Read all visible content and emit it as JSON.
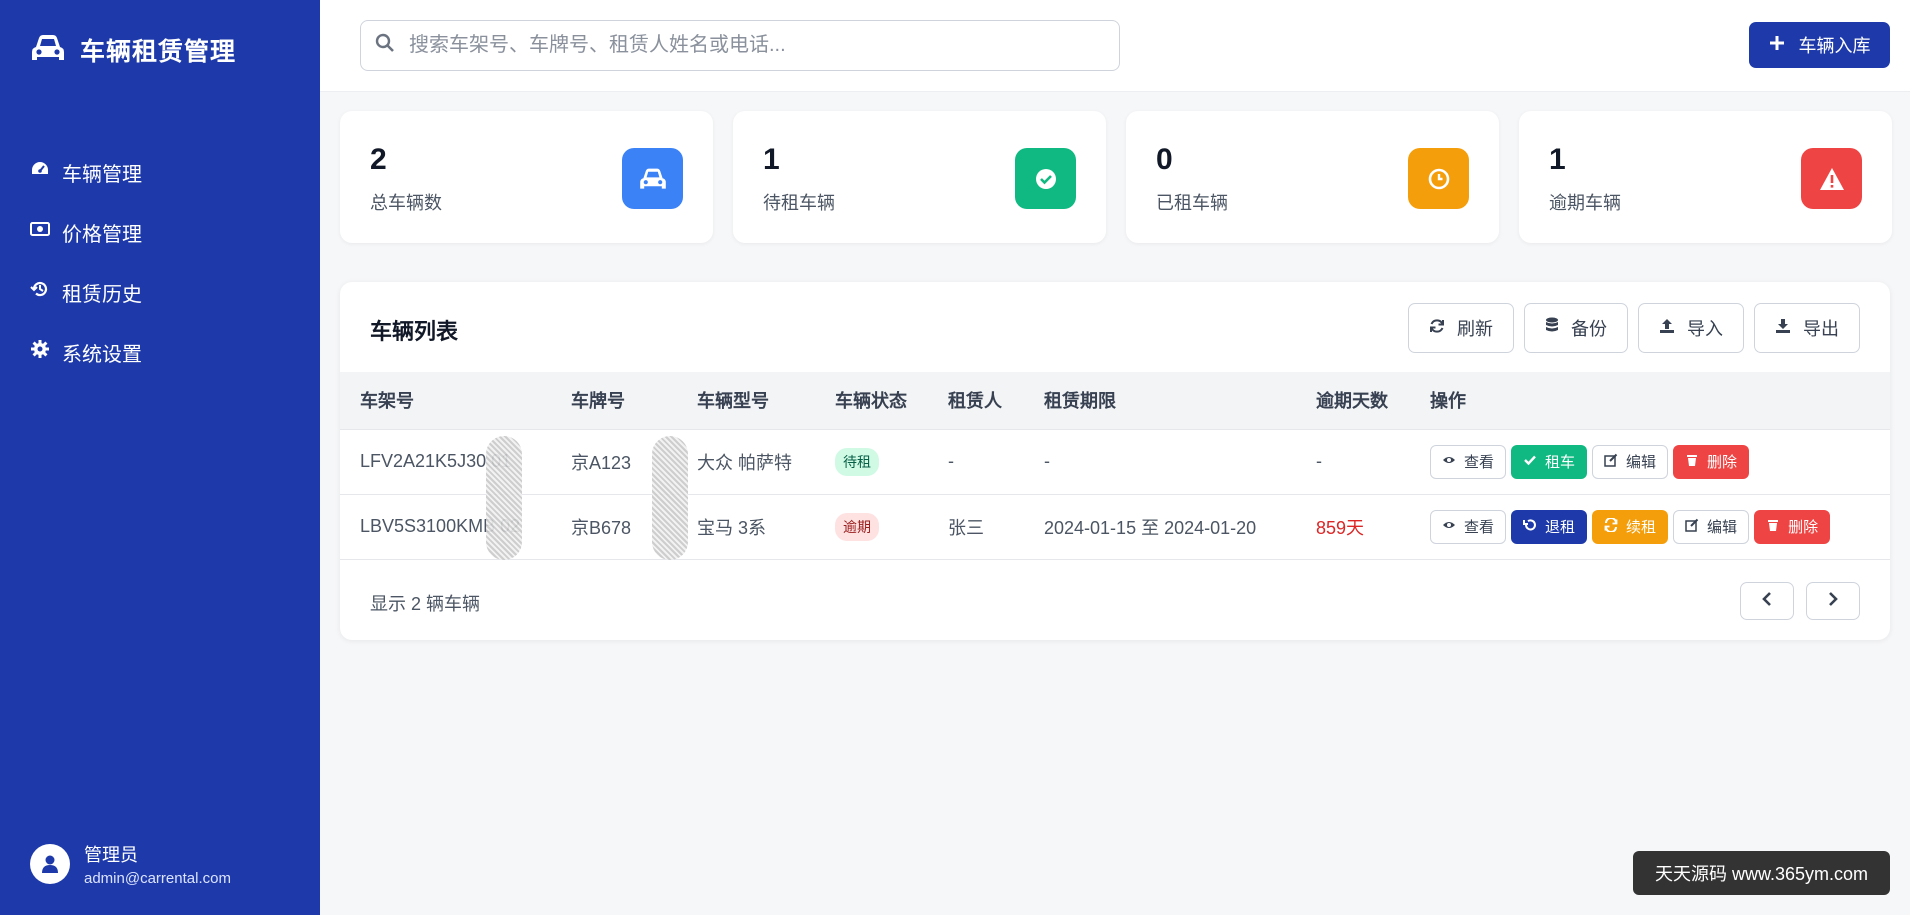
{
  "app": {
    "title": "车辆租赁管理"
  },
  "sidebar": {
    "items": [
      {
        "label": "车辆管理",
        "icon": "dashboard-icon"
      },
      {
        "label": "价格管理",
        "icon": "money-icon"
      },
      {
        "label": "租赁历史",
        "icon": "history-icon"
      },
      {
        "label": "系统设置",
        "icon": "gear-icon"
      }
    ],
    "user": {
      "name": "管理员",
      "email": "admin@carrental.com"
    }
  },
  "topbar": {
    "search_placeholder": "搜索车架号、车牌号、租赁人姓名或电话...",
    "add_label": "车辆入库"
  },
  "stats": [
    {
      "value": "2",
      "label": "总车辆数",
      "color": "#3b82f6",
      "icon": "car-icon"
    },
    {
      "value": "1",
      "label": "待租车辆",
      "color": "#10b981",
      "icon": "check-circle-icon"
    },
    {
      "value": "0",
      "label": "已租车辆",
      "color": "#f59e0b",
      "icon": "clock-icon"
    },
    {
      "value": "1",
      "label": "逾期车辆",
      "color": "#ef4444",
      "icon": "warning-icon"
    }
  ],
  "vehicle_list": {
    "title": "车辆列表",
    "toolbar": {
      "refresh": "刷新",
      "backup": "备份",
      "import": "导入",
      "export": "导出"
    },
    "columns": [
      "车架号",
      "车牌号",
      "车辆型号",
      "车辆状态",
      "租赁人",
      "租赁期限",
      "逾期天数",
      "操作"
    ],
    "rows": [
      {
        "vin": "LFV2A21K5J30  01",
        "plate": "京A123",
        "model": "大众 帕萨特",
        "status": "待租",
        "renter": "-",
        "period": "-",
        "overdue": "-",
        "actions": [
          "查看",
          "租车",
          "编辑",
          "删除"
        ]
      },
      {
        "vin": "LBV5S3100KMB  02",
        "plate": "京B678",
        "model": "宝马 3系",
        "status": "逾期",
        "renter": "张三",
        "period": "2024-01-15 至 2024-01-20",
        "overdue": "859天",
        "actions": [
          "查看",
          "退租",
          "续租",
          "编辑",
          "删除"
        ]
      }
    ],
    "footer": "显示 2 辆车辆"
  },
  "watermark": "天天源码 www.365ym.com"
}
